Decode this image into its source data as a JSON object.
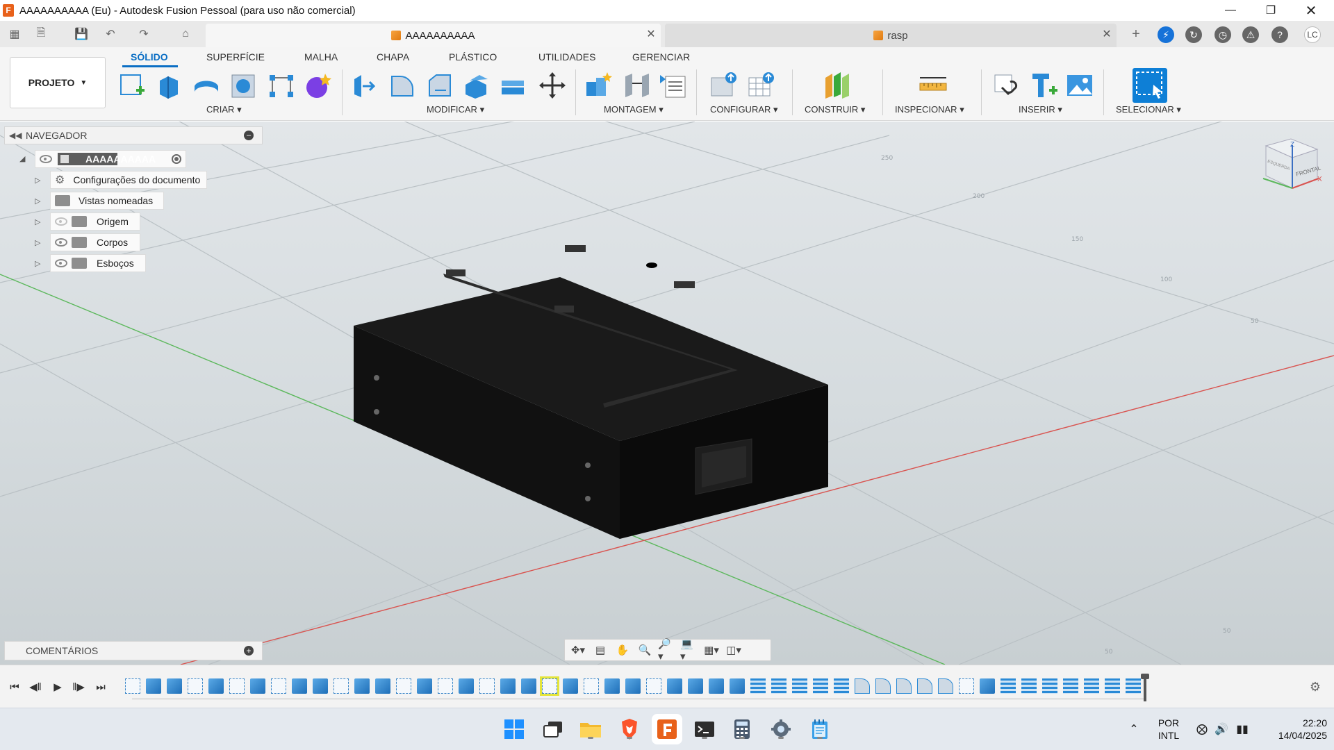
{
  "window": {
    "title": "AAAAAAAAAA (Eu) - Autodesk Fusion Pessoal (para uso não comercial)",
    "app_logo": "F",
    "controls": [
      "minimize-icon",
      "restore-icon",
      "close-icon"
    ]
  },
  "tabs": {
    "active": "AAAAAAAAAA",
    "inactive": "rasp",
    "user_initials": "LC"
  },
  "ribbon": {
    "project_label": "PROJETO",
    "workspaces": [
      "SÓLIDO",
      "SUPERFÍCIE",
      "MALHA",
      "CHAPA",
      "PLÁSTICO",
      "UTILIDADES",
      "GERENCIAR"
    ],
    "active_workspace": "SÓLIDO",
    "groups": {
      "create": "CRIAR",
      "modify": "MODIFICAR",
      "assembly": "MONTAGEM",
      "configure": "CONFIGURAR",
      "construct": "CONSTRUIR",
      "inspect": "INSPECIONAR",
      "insert": "INSERIR",
      "select": "SELECIONAR"
    },
    "colors": {
      "accent": "#0a6ec4",
      "tool_blue": "#2a8ad6",
      "select_blue": "#0e7fd6",
      "body_purple": "#7b3fe4"
    }
  },
  "navigator": {
    "title": "NAVEGADOR",
    "root": "AAAAAAAAAA",
    "items": [
      {
        "label": "Configurações do documento",
        "icon": "gear-icon"
      },
      {
        "label": "Vistas nomeadas",
        "icon": "folder-icon"
      },
      {
        "label": "Origem",
        "icon": "folder-icon",
        "visibility": "hidden"
      },
      {
        "label": "Corpos",
        "icon": "folder-icon",
        "visibility": "visible"
      },
      {
        "label": "Esboços",
        "icon": "folder-icon",
        "visibility": "visible"
      }
    ]
  },
  "comments": {
    "label": "COMENTÁRIOS"
  },
  "viewcube": {
    "front": "FRONTAL",
    "left": "ESQUERDA",
    "z_label": "Z",
    "x_label": "X"
  },
  "grid": {
    "tick_labels": [
      "250",
      "200",
      "150",
      "100",
      "50",
      "50",
      "50"
    ]
  },
  "taskbar": {
    "language": "POR",
    "layout": "INTL",
    "time": "22:20",
    "date": "14/04/2025"
  }
}
